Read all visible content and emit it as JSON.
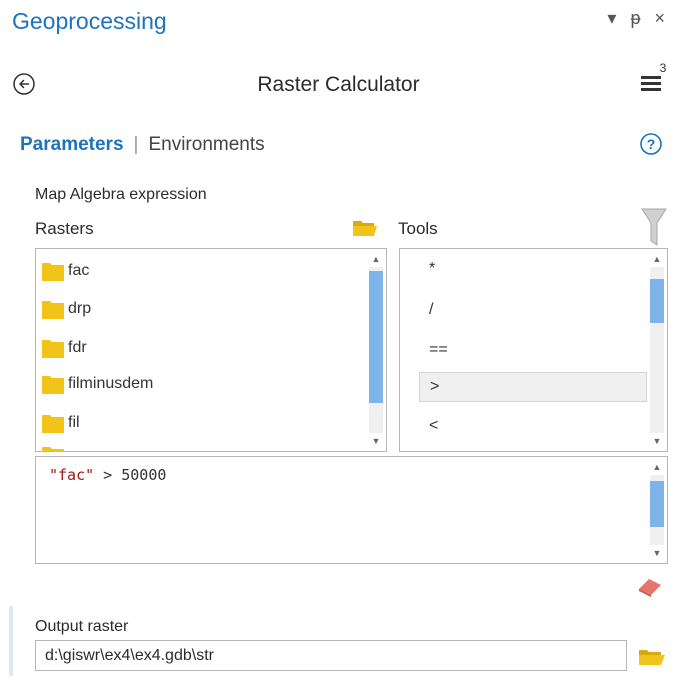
{
  "pane": {
    "title": "Geoprocessing",
    "controls": {
      "options": "▾",
      "pin": "ᵽ",
      "close": "×"
    }
  },
  "tool": {
    "title": "Raster Calculator",
    "menu_badge": "3"
  },
  "tabs": {
    "parameters": "Parameters",
    "separator": "|",
    "environments": "Environments"
  },
  "section": {
    "expression_label": "Map Algebra expression",
    "rasters_label": "Rasters",
    "tools_label": "Tools"
  },
  "rasters": [
    {
      "label": "fac"
    },
    {
      "label": "drp"
    },
    {
      "label": "fdr"
    },
    {
      "label": "filminusdem"
    },
    {
      "label": "fil"
    }
  ],
  "tools": [
    {
      "label": "*"
    },
    {
      "label": "/"
    },
    {
      "label": "=="
    },
    {
      "label": ">"
    },
    {
      "label": "<"
    }
  ],
  "selected_tool_index": 3,
  "expression": {
    "string_part": "\"fac\"",
    "rest": " > 50000"
  },
  "output": {
    "label": "Output raster",
    "value": "d:\\giswr\\ex4\\ex4.gdb\\str"
  },
  "colors": {
    "accent": "#1e73be",
    "scroll_thumb": "#7eb4ea",
    "folder": "#f2c318",
    "string_literal": "#a31515",
    "eraser": "#e8756b"
  },
  "icons": {
    "back": "back-arrow-icon",
    "menu": "menu-icon",
    "help": "help-icon",
    "folder": "folder-icon",
    "filter": "filter-icon",
    "eraser": "eraser-icon"
  }
}
